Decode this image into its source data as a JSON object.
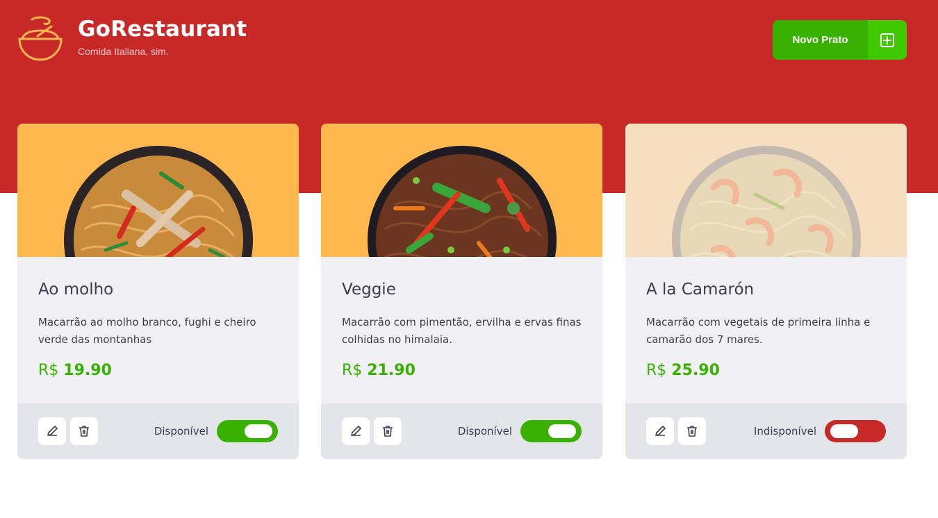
{
  "brand": {
    "title": "GoRestaurant",
    "subtitle": "Comida Italiana, sim.",
    "logo_icon": "bowl-icon"
  },
  "header": {
    "new_dish_label": "Novo Prato",
    "new_dish_icon": "plus-square-icon"
  },
  "colors": {
    "header_red": "#c72828",
    "green": "#39b100",
    "image_bg": "#ffb84d"
  },
  "dishes": [
    {
      "name": "Ao molho",
      "description": "Macarrão ao molho branco, fughi e cheiro verde das montanhas",
      "currency": "R$",
      "price": "19.90",
      "availability_label": "Disponível",
      "available": true
    },
    {
      "name": "Veggie",
      "description": "Macarrão com pimentão, ervilha e ervas finas colhidas no himalaia.",
      "currency": "R$",
      "price": "21.90",
      "availability_label": "Disponível",
      "available": true
    },
    {
      "name": "A la Camarón",
      "description": "Macarrão com vegetais de primeira linha e camarão dos 7 mares.",
      "currency": "R$",
      "price": "25.90",
      "availability_label": "Indisponível",
      "available": false
    }
  ]
}
